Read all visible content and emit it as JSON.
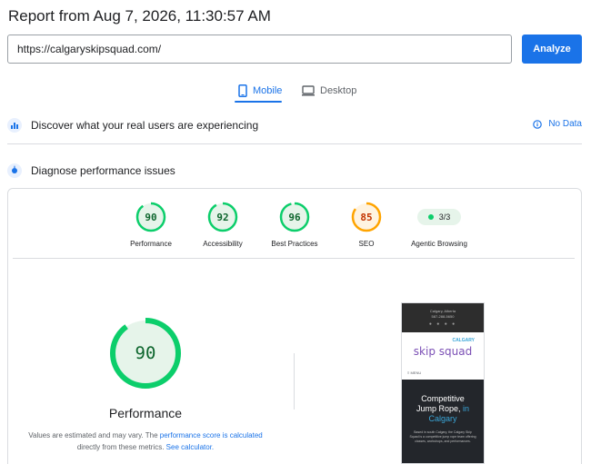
{
  "header": {
    "title": "Report from Aug 7, 2026, 11:30:57 AM"
  },
  "url_bar": {
    "value": "https://calgaryskipsquad.com/",
    "analyze_label": "Analyze"
  },
  "tabs": [
    {
      "label": "Mobile",
      "icon": "phone-icon",
      "active": true
    },
    {
      "label": "Desktop",
      "icon": "monitor-icon",
      "active": false
    }
  ],
  "sections": {
    "discover": {
      "label": "Discover what your real users are experiencing",
      "status": "No Data",
      "icon": "people-chart-icon"
    },
    "diagnose": {
      "label": "Diagnose performance issues",
      "icon": "lighthouse-icon"
    }
  },
  "scores": [
    {
      "label": "Performance",
      "value": "90",
      "color": "#0cce6b",
      "fraction": 0.9
    },
    {
      "label": "Accessibility",
      "value": "92",
      "color": "#0cce6b",
      "fraction": 0.92
    },
    {
      "label": "Best Practices",
      "value": "96",
      "color": "#0cce6b",
      "fraction": 0.96
    },
    {
      "label": "SEO",
      "value": "85",
      "color": "#ffa400",
      "fraction": 0.85
    }
  ],
  "agentic": {
    "value": "3/3",
    "label": "Agentic Browsing"
  },
  "performance_detail": {
    "score": "90",
    "label": "Performance",
    "desc_pre": "Values are estimated and may vary. The ",
    "desc_link1": "performance score is calculated",
    "desc_mid": " directly from these metrics. ",
    "desc_link2": "See calculator."
  },
  "screenshot": {
    "topline1": "Calgary, Alberta",
    "topline2": "587-288-5650",
    "dots": "● ● ● ●",
    "logo": "skip squad",
    "logo_small": "CALGARY",
    "menu": "≡ MENU",
    "hero_line1": "Competitive",
    "hero_line2": "Jump Rope,",
    "hero_accent": "in",
    "hero_line3": "Calgary",
    "hero_para": "Based in south Calgary, the Calgary Skip Squad is a competitive jump rope team offering classes, workshops, and performances."
  },
  "colors": {
    "accent": "#1a73e8",
    "pass": "#0cce6b",
    "average": "#ffa400"
  }
}
